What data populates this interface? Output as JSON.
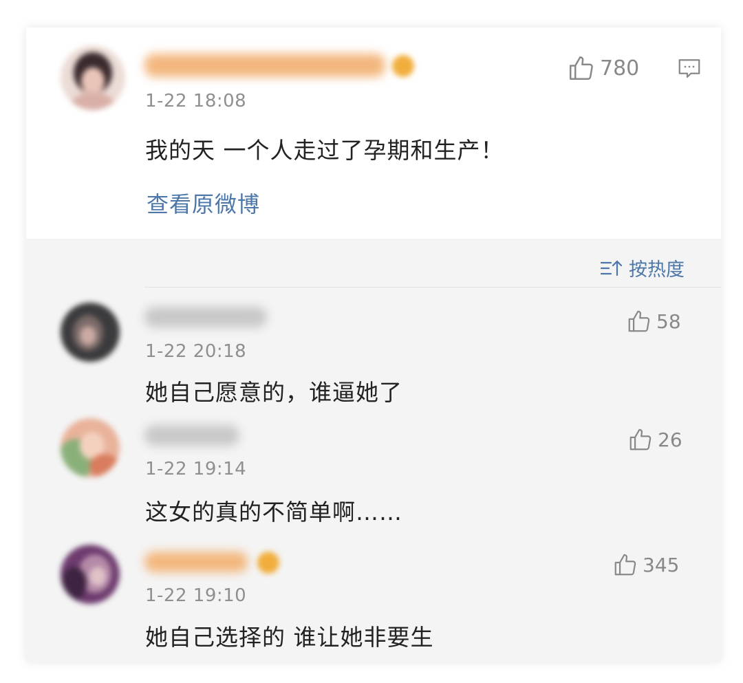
{
  "post": {
    "time": "1-22 18:08",
    "text": "我的天 一个人走过了孕期和生产！",
    "likes": "780",
    "view_original": "查看原微博",
    "like_icon": "thumb-up-icon",
    "reply_icon": "comment-icon"
  },
  "sort": {
    "icon": "sort-icon",
    "label": "按热度"
  },
  "comments": [
    {
      "time": "1-22 20:18",
      "text": "她自己愿意的，谁逼她了",
      "likes": "58"
    },
    {
      "time": "1-22 19:14",
      "text": "这女的真的不简单啊……",
      "likes": "26"
    },
    {
      "time": "1-22 19:10",
      "text": "她自己选择的 谁让她非要生",
      "likes": "345"
    }
  ],
  "colors": {
    "link": "#4d77a8",
    "name_orange": "#f1ae3c",
    "name_gray": "#c8c8c8",
    "card_bg": "#f4f4f4"
  }
}
